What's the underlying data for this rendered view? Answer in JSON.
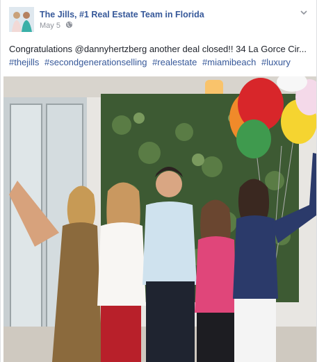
{
  "post": {
    "page_name": "The Jills, #1 Real Estate Team in Florida",
    "date": "May 5",
    "privacy_icon": "globe-icon",
    "menu_icon": "chevron-down-icon",
    "message": "Congratulations @dannyhertzberg another deal closed!! 34 La Gorce Cir...",
    "hashtags": [
      "#thejills",
      "#secondgenerationselling",
      "#realestate",
      "#miamibeach",
      "#luxury"
    ]
  },
  "photo": {
    "description_icon": "group-photo-with-balloons",
    "colors": {
      "wall": "#e8e6e2",
      "green_wall": "#3d5a33",
      "balloon_red": "#d8262a",
      "balloon_orange": "#f08a2a",
      "balloon_yellow": "#f5d430",
      "balloon_green": "#3f9a4e"
    }
  },
  "colors": {
    "link": "#365899",
    "meta": "#90949c",
    "text": "#1d2129"
  }
}
